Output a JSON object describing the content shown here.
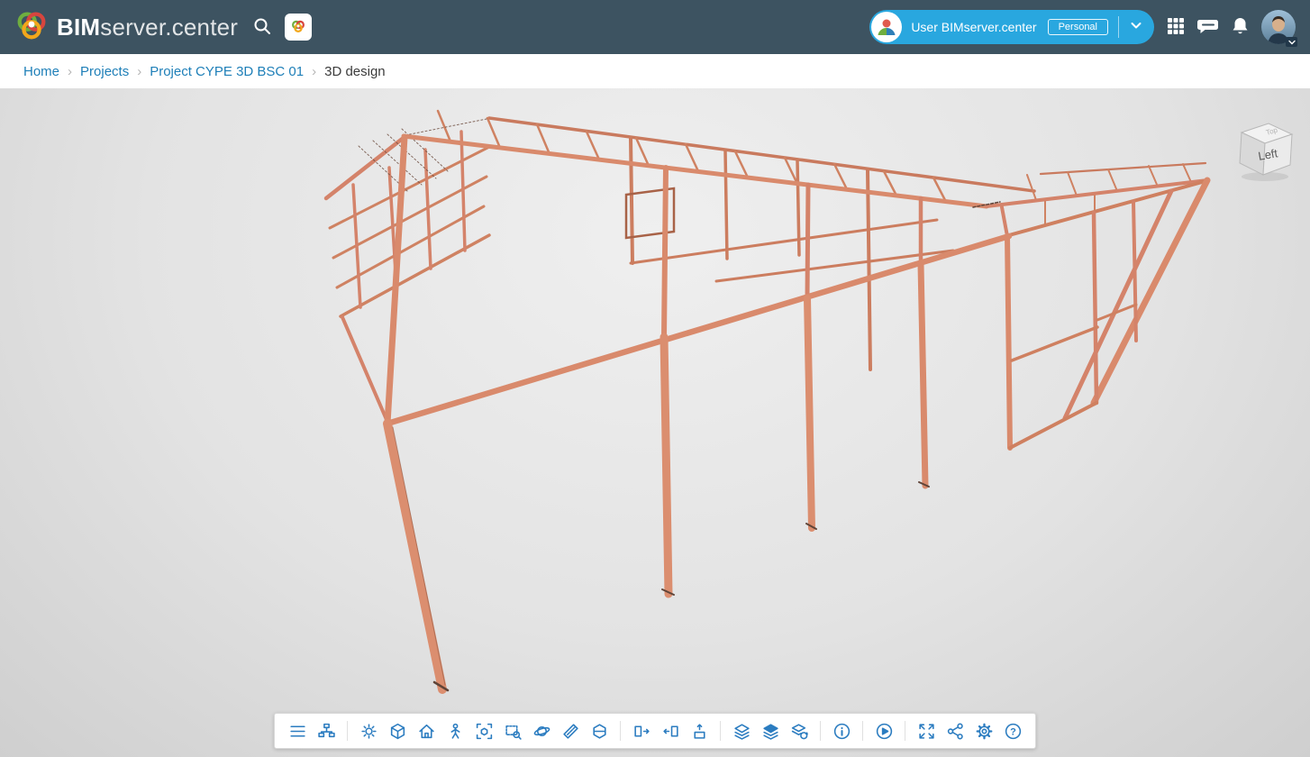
{
  "header": {
    "brand_bold": "BIM",
    "brand_light": "server.center",
    "user": {
      "name": "User BIMserver.center",
      "badge": "Personal"
    }
  },
  "breadcrumb": {
    "separator": "›",
    "items": [
      {
        "label": "Home"
      },
      {
        "label": "Projects"
      },
      {
        "label": "Project CYPE 3D BSC 01"
      }
    ],
    "current": "3D design"
  },
  "viewcube": {
    "front_label": "Left",
    "top_label": "Top"
  },
  "toolbar": {
    "items": [
      "menu",
      "project-tree",
      "brightness",
      "isometric-view",
      "home-view",
      "first-person-view",
      "zoom-extents",
      "zoom-window",
      "orbit",
      "measure",
      "section-box",
      "clip-front",
      "clip-side",
      "clip-plan",
      "layers",
      "layer-visibility",
      "layer-link",
      "information",
      "animation",
      "fullscreen",
      "share",
      "settings",
      "help"
    ]
  },
  "colors": {
    "header_bg": "#3d5361",
    "accent_blue": "#29a7df",
    "toolbar_icon": "#2b7cc0",
    "structure": "#d98a6c",
    "link": "#1e7fb8"
  }
}
